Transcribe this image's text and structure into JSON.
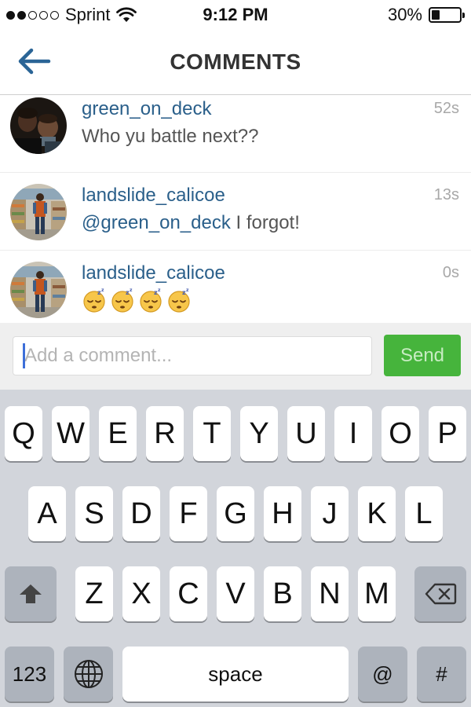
{
  "status_bar": {
    "signal_bars_full": 2,
    "signal_bars_total": 5,
    "carrier": "Sprint",
    "time": "9:12 PM",
    "battery_percent": "30%",
    "battery_level": 0.3
  },
  "nav": {
    "title": "COMMENTS",
    "back_icon": "back-arrow-icon",
    "accent_color": "#2a6496"
  },
  "comments": [
    {
      "username": "green_on_deck",
      "time": "52s",
      "text": "Who yu battle next??"
    },
    {
      "username": "landslide_calicoe",
      "time": "13s",
      "mention": "@green_on_deck",
      "text": " I forgot!"
    },
    {
      "username": "landslide_calicoe",
      "time": "0s",
      "emoji_icons": [
        "sleeping-face-icon",
        "sleeping-face-icon",
        "sleeping-face-icon",
        "sleeping-face-icon"
      ]
    }
  ],
  "input": {
    "placeholder": "Add a comment...",
    "value": "",
    "send_label": "Send",
    "send_color": "#46b43c"
  },
  "keyboard": {
    "row1": [
      "Q",
      "W",
      "E",
      "R",
      "T",
      "Y",
      "U",
      "I",
      "O",
      "P"
    ],
    "row2": [
      "A",
      "S",
      "D",
      "F",
      "G",
      "H",
      "J",
      "K",
      "L"
    ],
    "row3": [
      "Z",
      "X",
      "C",
      "V",
      "B",
      "N",
      "M"
    ],
    "shift_icon": "shift-icon",
    "delete_icon": "delete-icon",
    "numbers_label": "123",
    "globe_icon": "globe-icon",
    "space_label": "space",
    "at_label": "@",
    "hash_label": "#"
  }
}
